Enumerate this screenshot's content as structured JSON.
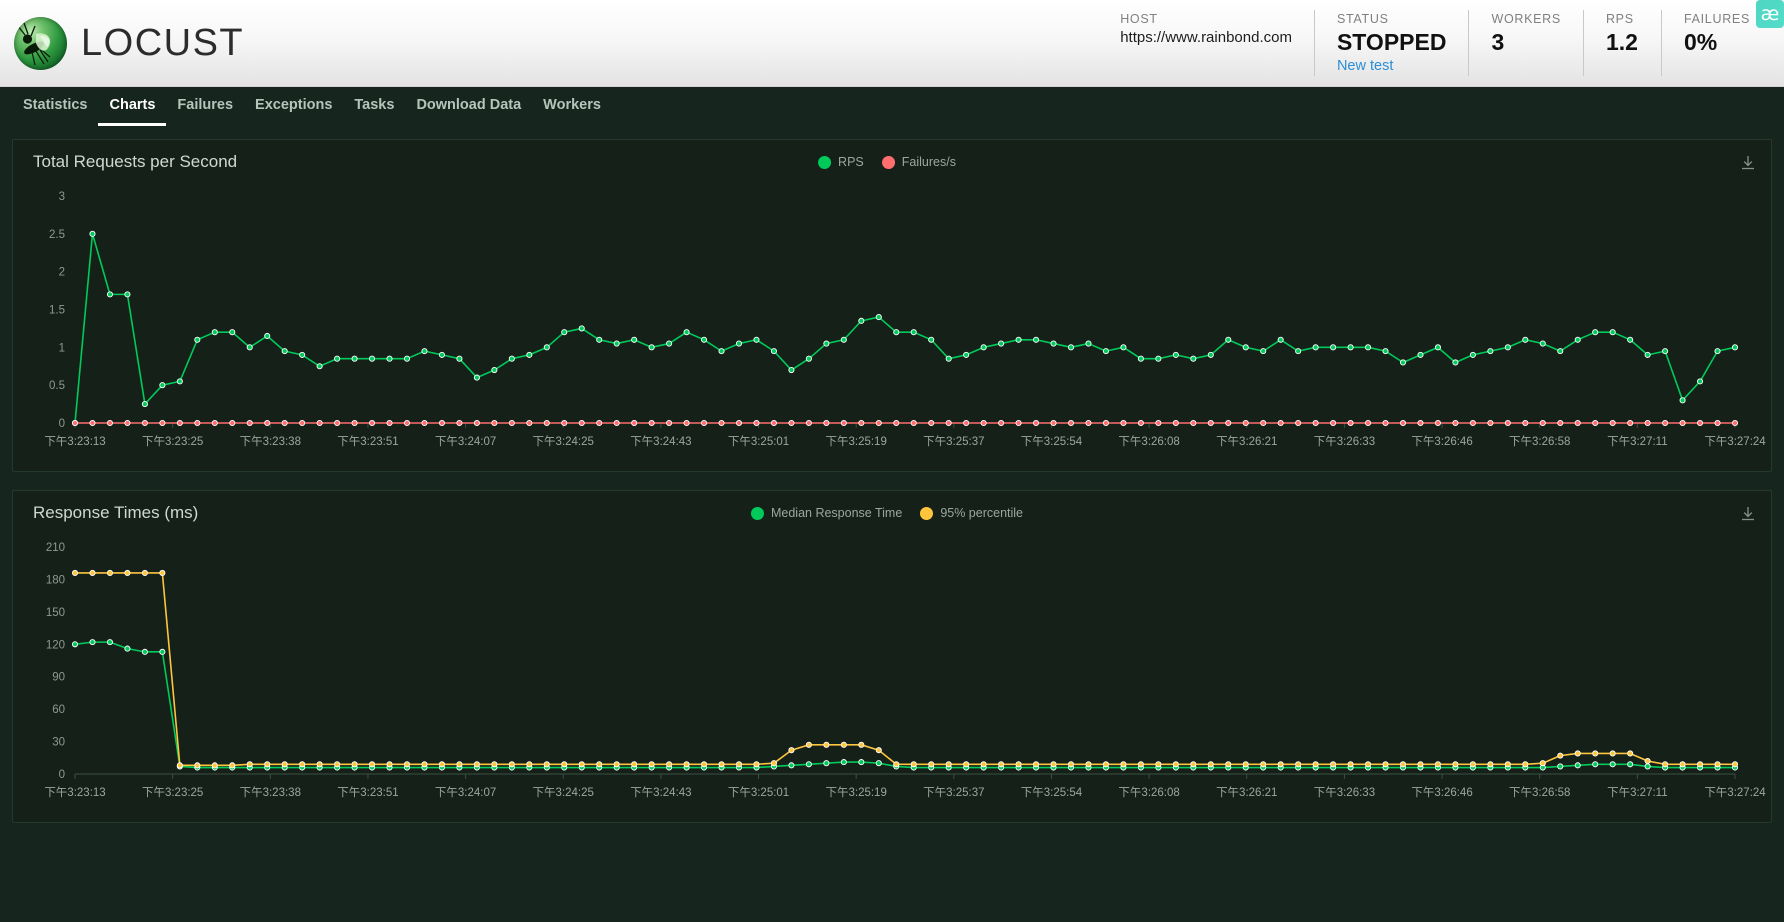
{
  "app": {
    "brand": "LOCUST",
    "logo_icon": "locust-bug-logo"
  },
  "header": {
    "stats": [
      {
        "id": "host",
        "label": "HOST",
        "value": "https://www.rainbond.com",
        "size": "small"
      },
      {
        "id": "status",
        "label": "STATUS",
        "value": "STOPPED",
        "size": "large",
        "link": "New test"
      },
      {
        "id": "workers",
        "label": "WORKERS",
        "value": "3",
        "size": "large"
      },
      {
        "id": "rps",
        "label": "RPS",
        "value": "1.2",
        "size": "large"
      },
      {
        "id": "failures",
        "label": "FAILURES",
        "value": "0%",
        "size": "large"
      }
    ],
    "extension_badge": "æ"
  },
  "nav": {
    "items": [
      {
        "label": "Statistics",
        "active": false
      },
      {
        "label": "Charts",
        "active": true
      },
      {
        "label": "Failures",
        "active": false
      },
      {
        "label": "Exceptions",
        "active": false
      },
      {
        "label": "Tasks",
        "active": false
      },
      {
        "label": "Download Data",
        "active": false
      },
      {
        "label": "Workers",
        "active": false
      }
    ]
  },
  "colors": {
    "rps_green": "#00ca5a",
    "failures_red": "#ff6d6d",
    "median_green": "#00ca5a",
    "percentile_yellow": "#ffc53d",
    "panel_bg": "#152019",
    "page_bg": "#16261e",
    "axis": "#8d9a91",
    "accent_link": "#2b8fd6"
  },
  "download_icon": "download-arrow-icon",
  "chart_data": [
    {
      "id": "total-requests-per-second",
      "type": "line",
      "title": "Total Requests per Second",
      "xlabel": "",
      "ylabel": "",
      "ylim": [
        0,
        3
      ],
      "yticks": [
        0,
        0.5,
        1,
        1.5,
        2,
        2.5,
        3
      ],
      "ytick_labels": [
        "0",
        "0.5",
        "1",
        "1.5",
        "2",
        "2.5",
        "3"
      ],
      "grid": false,
      "legend_position": "top-center",
      "xtick_labels": [
        "下午3:23:13",
        "下午3:23:25",
        "下午3:23:38",
        "下午3:23:51",
        "下午3:24:07",
        "下午3:24:25",
        "下午3:24:43",
        "下午3:25:01",
        "下午3:25:19",
        "下午3:25:37",
        "下午3:25:54",
        "下午3:26:08",
        "下午3:26:21",
        "下午3:26:33",
        "下午3:26:46",
        "下午3:26:58",
        "下午3:27:11",
        "下午3:27:24"
      ],
      "series": [
        {
          "name": "RPS",
          "color": "#00ca5a",
          "values": [
            0,
            2.5,
            1.7,
            1.7,
            0.25,
            0.5,
            0.55,
            1.1,
            1.2,
            1.2,
            1.0,
            1.15,
            0.95,
            0.9,
            0.75,
            0.85,
            0.85,
            0.85,
            0.85,
            0.85,
            0.95,
            0.9,
            0.85,
            0.6,
            0.7,
            0.85,
            0.9,
            1.0,
            1.2,
            1.25,
            1.1,
            1.05,
            1.1,
            1.0,
            1.05,
            1.2,
            1.1,
            0.95,
            1.05,
            1.1,
            0.95,
            0.7,
            0.85,
            1.05,
            1.1,
            1.35,
            1.4,
            1.2,
            1.2,
            1.1,
            0.85,
            0.9,
            1.0,
            1.05,
            1.1,
            1.1,
            1.05,
            1.0,
            1.05,
            0.95,
            1.0,
            0.85,
            0.85,
            0.9,
            0.85,
            0.9,
            1.1,
            1.0,
            0.95,
            1.1,
            0.95,
            1.0,
            1.0,
            1.0,
            1.0,
            0.95,
            0.8,
            0.9,
            1.0,
            0.8,
            0.9,
            0.95,
            1.0,
            1.1,
            1.05,
            0.95,
            1.1,
            1.2,
            1.2,
            1.1,
            0.9,
            0.95,
            0.3,
            0.55,
            0.95,
            1.0
          ]
        },
        {
          "name": "Failures/s",
          "color": "#ff6d6d",
          "values": [
            0,
            0,
            0,
            0,
            0,
            0,
            0,
            0,
            0,
            0,
            0,
            0,
            0,
            0,
            0,
            0,
            0,
            0,
            0,
            0,
            0,
            0,
            0,
            0,
            0,
            0,
            0,
            0,
            0,
            0,
            0,
            0,
            0,
            0,
            0,
            0,
            0,
            0,
            0,
            0,
            0,
            0,
            0,
            0,
            0,
            0,
            0,
            0,
            0,
            0,
            0,
            0,
            0,
            0,
            0,
            0,
            0,
            0,
            0,
            0,
            0,
            0,
            0,
            0,
            0,
            0,
            0,
            0,
            0,
            0,
            0,
            0,
            0,
            0,
            0,
            0,
            0,
            0,
            0,
            0,
            0,
            0,
            0,
            0,
            0,
            0,
            0,
            0,
            0,
            0,
            0,
            0,
            0,
            0,
            0,
            0
          ]
        }
      ]
    },
    {
      "id": "response-times-ms",
      "type": "line",
      "title": "Response Times (ms)",
      "xlabel": "",
      "ylabel": "",
      "ylim": [
        0,
        210
      ],
      "yticks": [
        0,
        30,
        60,
        90,
        120,
        150,
        180,
        210
      ],
      "ytick_labels": [
        "0",
        "30",
        "60",
        "90",
        "120",
        "150",
        "180",
        "210"
      ],
      "grid": false,
      "legend_position": "top-center",
      "xtick_labels": [
        "下午3:23:13",
        "下午3:23:25",
        "下午3:23:38",
        "下午3:23:51",
        "下午3:24:07",
        "下午3:24:25",
        "下午3:24:43",
        "下午3:25:01",
        "下午3:25:19",
        "下午3:25:37",
        "下午3:25:54",
        "下午3:26:08",
        "下午3:26:21",
        "下午3:26:33",
        "下午3:26:46",
        "下午3:26:58",
        "下午3:27:11",
        "下午3:27:24"
      ],
      "series": [
        {
          "name": "Median Response Time",
          "color": "#00ca5a",
          "values": [
            120,
            122,
            122,
            116,
            113,
            113,
            7,
            6,
            6,
            6,
            6,
            6,
            6,
            6,
            6,
            6,
            6,
            6,
            6,
            6,
            6,
            6,
            6,
            6,
            6,
            6,
            6,
            6,
            6,
            6,
            6,
            6,
            6,
            6,
            6,
            6,
            6,
            6,
            6,
            6,
            7,
            8,
            9,
            10,
            11,
            11,
            10,
            7,
            6,
            6,
            6,
            6,
            6,
            6,
            6,
            6,
            6,
            6,
            6,
            6,
            6,
            6,
            6,
            6,
            6,
            6,
            6,
            6,
            6,
            6,
            6,
            6,
            6,
            6,
            6,
            6,
            6,
            6,
            6,
            6,
            6,
            6,
            6,
            6,
            6,
            7,
            8,
            9,
            9,
            9,
            7,
            6,
            6,
            6,
            6,
            6
          ]
        },
        {
          "name": "95% percentile",
          "color": "#ffc53d",
          "values": [
            186,
            186,
            186,
            186,
            186,
            186,
            8,
            8,
            8,
            8,
            9,
            9,
            9,
            9,
            9,
            9,
            9,
            9,
            9,
            9,
            9,
            9,
            9,
            9,
            9,
            9,
            9,
            9,
            9,
            9,
            9,
            9,
            9,
            9,
            9,
            9,
            9,
            9,
            9,
            9,
            10,
            22,
            27,
            27,
            27,
            27,
            22,
            9,
            9,
            9,
            9,
            9,
            9,
            9,
            9,
            9,
            9,
            9,
            9,
            9,
            9,
            9,
            9,
            9,
            9,
            9,
            9,
            9,
            9,
            9,
            9,
            9,
            9,
            9,
            9,
            9,
            9,
            9,
            9,
            9,
            9,
            9,
            9,
            9,
            10,
            17,
            19,
            19,
            19,
            19,
            12,
            9,
            9,
            9,
            9,
            9
          ]
        }
      ]
    }
  ]
}
